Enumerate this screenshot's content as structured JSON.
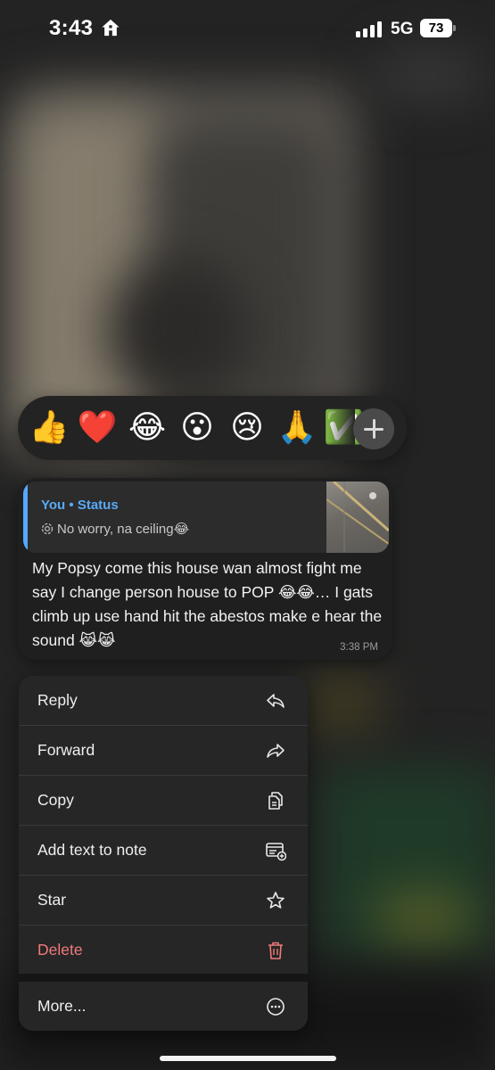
{
  "status_bar": {
    "time": "3:43",
    "network": "5G",
    "battery": "73"
  },
  "reactions": {
    "emojis": [
      "👍",
      "❤️",
      "😂",
      "😮",
      "😢",
      "🙏",
      "✅"
    ],
    "more_icon": "plus-icon"
  },
  "message": {
    "reply_sender": "You",
    "reply_separator": " • ",
    "reply_source": "Status",
    "reply_snippet": "No worry, na ceiling😂",
    "text": "My Popsy come this house wan almost fight me say I change person house to POP 😂😂… I gats climb up use hand hit the abestos make e hear the sound 😹😹",
    "time": "3:38 PM"
  },
  "menu": {
    "items": [
      {
        "label": "Reply",
        "icon": "reply-arrow-icon"
      },
      {
        "label": "Forward",
        "icon": "forward-arrow-icon"
      },
      {
        "label": "Copy",
        "icon": "copy-icon"
      },
      {
        "label": "Add text to note",
        "icon": "add-note-icon"
      },
      {
        "label": "Star",
        "icon": "star-icon"
      },
      {
        "label": "Delete",
        "icon": "trash-icon"
      },
      {
        "label": "More...",
        "icon": "more-circle-icon"
      }
    ],
    "danger_color": "#f07a7a"
  },
  "colors": {
    "accent_blue": "#58a9f6",
    "menu_bg": "#262626",
    "bubble_bg": "#1f1f1f"
  }
}
